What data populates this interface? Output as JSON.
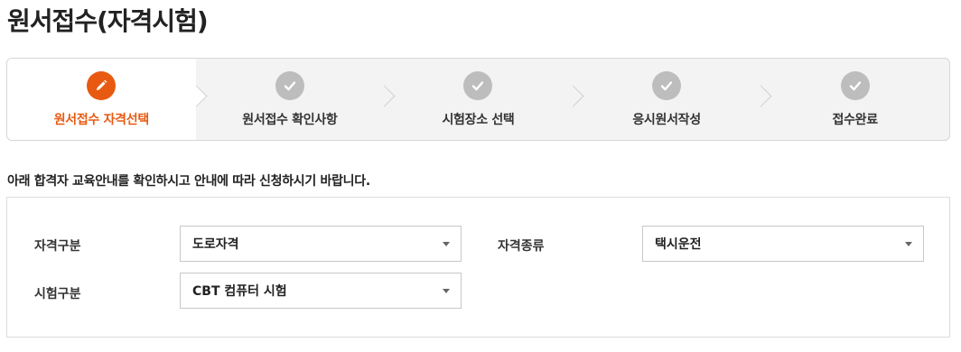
{
  "page": {
    "title": "원서접수(자격시험)"
  },
  "steps": [
    {
      "label": "원서접수 자격선택",
      "state": "active",
      "icon": "pencil-icon"
    },
    {
      "label": "원서접수 확인사항",
      "state": "pending",
      "icon": "check-icon"
    },
    {
      "label": "시험장소 선택",
      "state": "pending",
      "icon": "check-icon"
    },
    {
      "label": "응시원서작성",
      "state": "pending",
      "icon": "check-icon"
    },
    {
      "label": "접수완료",
      "state": "pending",
      "icon": "check-icon"
    }
  ],
  "notice": "아래 합격자 교육안내를 확인하시고 안내에 따라 신청하시기 바랍니다.",
  "form": {
    "qual_category": {
      "label": "자격구분",
      "value": "도로자격"
    },
    "qual_type": {
      "label": "자격종류",
      "value": "택시운전"
    },
    "exam_type": {
      "label": "시험구분",
      "value": "CBT 컴퓨터 시험"
    }
  },
  "colors": {
    "accent": "#e85a12",
    "step_inactive_icon": "#bdbdbd",
    "step_bg": "#f3f3f3"
  }
}
